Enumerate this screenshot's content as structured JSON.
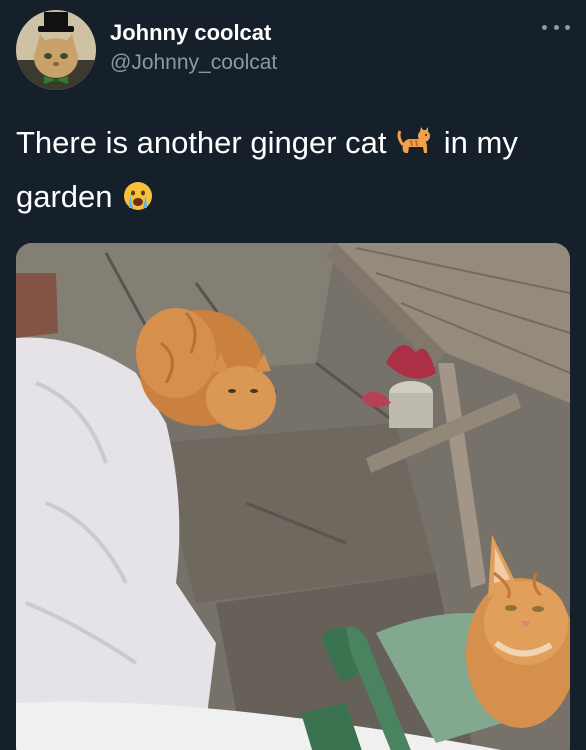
{
  "tweet": {
    "author": {
      "display_name": "Johnny coolcat",
      "handle": "@Johnny_coolcat",
      "avatar_icon": "cat-with-top-hat-avatar"
    },
    "more_icon": "more-horizontal-icon",
    "text_parts": {
      "part1": "There is another ginger cat",
      "part2": "in my",
      "part3": "garden"
    },
    "emojis": [
      "cat-emoji",
      "crying-face-emoji"
    ],
    "photo": {
      "subject": "two ginger cats in a garden seen through a window"
    }
  },
  "colors": {
    "background": "#15202b",
    "primary_text": "#ffffff",
    "secondary_text": "#8b98a5"
  }
}
